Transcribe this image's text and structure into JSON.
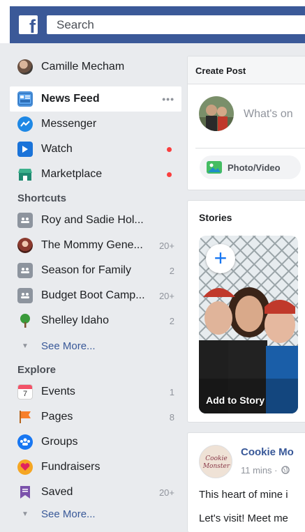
{
  "topbar": {
    "search_placeholder": "Search",
    "logo": "f"
  },
  "sidebar": {
    "profile": {
      "name": "Camille Mecham"
    },
    "main": [
      {
        "label": "News Feed",
        "icon": "news-feed-icon",
        "more": "•••"
      },
      {
        "label": "Messenger",
        "icon": "messenger-icon"
      },
      {
        "label": "Watch",
        "icon": "watch-icon"
      },
      {
        "label": "Marketplace",
        "icon": "marketplace-icon"
      }
    ],
    "shortcuts_heading": "Shortcuts",
    "shortcuts": [
      {
        "label": "Roy and Sadie Hol...",
        "count": ""
      },
      {
        "label": "The Mommy Gene...",
        "count": "20+"
      },
      {
        "label": "Season for Family",
        "count": "2"
      },
      {
        "label": "Budget Boot Camp...",
        "count": "20+"
      },
      {
        "label": "Shelley Idaho",
        "count": "2"
      }
    ],
    "shortcuts_see_more": "See More...",
    "explore_heading": "Explore",
    "explore": [
      {
        "label": "Events",
        "count": "1",
        "icon": "events-icon",
        "icon_text": "7"
      },
      {
        "label": "Pages",
        "count": "8",
        "icon": "pages-flag-icon"
      },
      {
        "label": "Groups",
        "count": "",
        "icon": "groups-icon"
      },
      {
        "label": "Fundraisers",
        "count": "",
        "icon": "fundraisers-icon"
      },
      {
        "label": "Saved",
        "count": "20+",
        "icon": "saved-icon"
      }
    ],
    "explore_see_more": "See More..."
  },
  "create_post": {
    "title": "Create Post",
    "placeholder": "What's on",
    "photo_video": "Photo/Video"
  },
  "stories": {
    "title": "Stories",
    "add_to_story": "Add to Story",
    "plus": "+"
  },
  "post": {
    "author": "Cookie Mo",
    "time": "11 mins ·",
    "text_line1": "This heart of mine i",
    "text_line2": "Let's visit! Meet me"
  },
  "colors": {
    "brand": "#3b5998",
    "link": "#385898",
    "notification": "#fa3e3e",
    "background": "#e9ebee"
  }
}
